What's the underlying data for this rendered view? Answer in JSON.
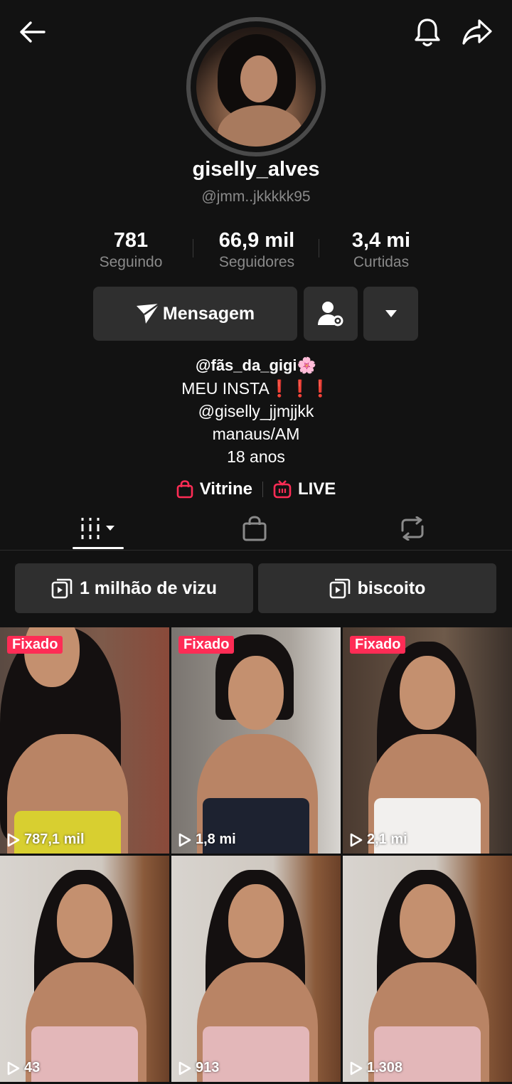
{
  "profile": {
    "display_name": "giselly_alves",
    "username": "@jmm..jkkkkk95"
  },
  "stats": [
    {
      "value": "781",
      "label": "Seguindo"
    },
    {
      "value": "66,9 mil",
      "label": "Seguidores"
    },
    {
      "value": "3,4 mi",
      "label": "Curtidas"
    }
  ],
  "actions": {
    "message_label": "Mensagem"
  },
  "bio": {
    "line1": "@fãs_da_gigi🌸",
    "line2": "MEU INSTA❗❗❗",
    "line3": "@giselly_jjmjjkk",
    "line4": "manaus/AM",
    "line5": "18 anos"
  },
  "links": {
    "shop": "Vitrine",
    "live": "LIVE"
  },
  "playlists": [
    {
      "label": "1 milhão de vizu"
    },
    {
      "label": "biscoito"
    }
  ],
  "videos": [
    {
      "views": "787,1 mil",
      "pinned_label": "Fixado"
    },
    {
      "views": "1,8 mi",
      "pinned_label": "Fixado"
    },
    {
      "views": "2,1 mi",
      "pinned_label": "Fixado"
    },
    {
      "views": "43"
    },
    {
      "views": "913"
    },
    {
      "views": "1.308"
    }
  ],
  "colors": {
    "background": "#121212",
    "button": "#2f2f2f",
    "accent": "#fe2c55",
    "secondary_text": "#8a8a8a"
  },
  "icons": [
    "back-arrow-icon",
    "bell-icon",
    "share-icon",
    "send-icon",
    "person-settings-icon",
    "caret-down-icon",
    "shopping-bag-icon",
    "live-tv-icon",
    "grid-icon",
    "repost-icon",
    "playlist-icon",
    "play-icon"
  ]
}
